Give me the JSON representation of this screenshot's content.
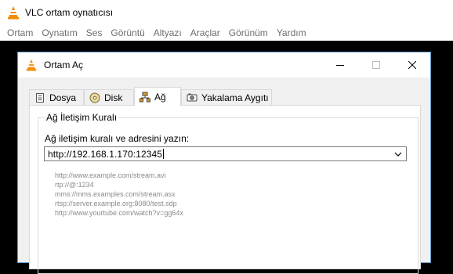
{
  "app": {
    "title": "VLC ortam oynatıcısı",
    "menu": [
      "Ortam",
      "Oynatım",
      "Ses",
      "Görüntü",
      "Altyazı",
      "Araçlar",
      "Görünüm",
      "Yardım"
    ]
  },
  "dialog": {
    "title": "Ortam Aç",
    "tabs": [
      {
        "label": "Dosya",
        "icon": "file-icon",
        "active": false
      },
      {
        "label": "Disk",
        "icon": "disc-icon",
        "active": false
      },
      {
        "label": "Ağ",
        "icon": "network-icon",
        "active": true
      },
      {
        "label": "Yakalama Aygıtı",
        "icon": "capture-device-icon",
        "active": false
      }
    ],
    "network": {
      "group_title": "Ağ İletişim Kuralı",
      "url_label": "Ağ iletişim kuralı ve adresini yazın:",
      "url_value": "http://192.168.1.170:12345",
      "examples": [
        "http://www.example.com/stream.avi",
        "rtp://@:1234",
        "mms://mms.examples.com/stream.asx",
        "rtsp://server.example.org:8080/test.sdp",
        "http://www.yourtube.com/watch?v=gg64x"
      ]
    }
  },
  "colors": {
    "accent_border": "#5b9bd5",
    "vlc_orange": "#f28c00"
  }
}
